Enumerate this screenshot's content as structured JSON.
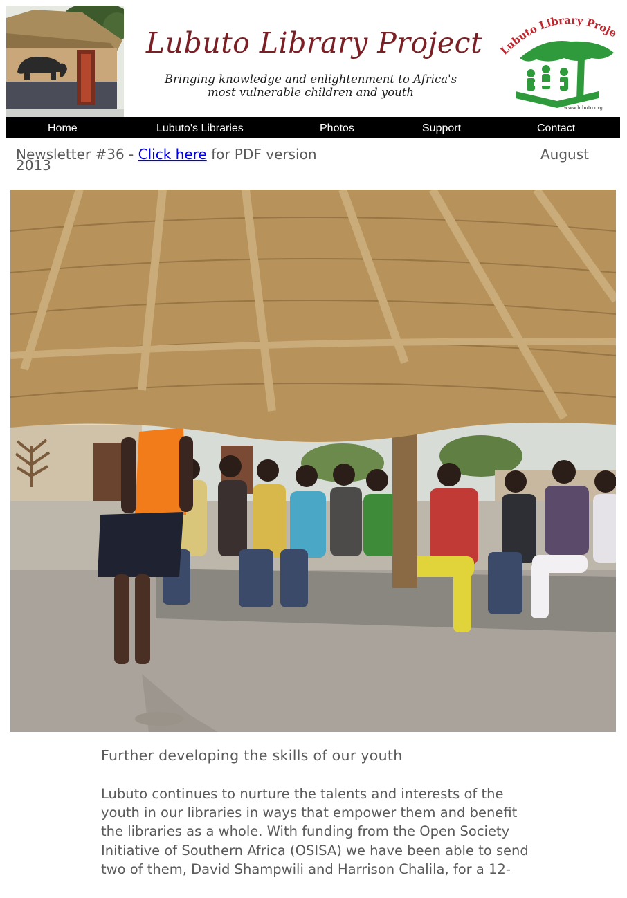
{
  "banner": {
    "title": "Lubuto Library Project",
    "tagline_line1": "Bringing knowledge and enlightenment to Africa's",
    "tagline_line2": "most vulnerable children and youth",
    "logo_text": "Lubuto Library Project",
    "logo_url": "www.lubuto.org"
  },
  "nav": {
    "items": [
      {
        "label": "Home"
      },
      {
        "label": "Lubuto's Libraries"
      },
      {
        "label": "Photos"
      },
      {
        "label": "Support"
      },
      {
        "label": "Contact"
      }
    ]
  },
  "issue": {
    "prefix": "Newsletter #36 - ",
    "link_label": "Click here",
    "suffix": " for PDF version",
    "month": "August",
    "year": "2013"
  },
  "article": {
    "heading": "Further developing the skills of our youth",
    "body_lines": [
      "Lubuto continues to nurture the talents and interests of the",
      "youth in our libraries in ways that empower them and benefit",
      "the libraries as a whole. With funding from the Open Society",
      "Initiative of Southern Africa (OSISA) we have been able to send",
      "two of them, David Shampwili and Harrison Chalila, for a 12-"
    ]
  },
  "colors": {
    "nav_background": "#000000",
    "nav_text": "#ffffff",
    "banner_title": "#7a1f24",
    "logo_green": "#2e9a3b",
    "logo_red": "#c0262d",
    "body_text": "#5a5a5a",
    "link": "#0000ee"
  }
}
